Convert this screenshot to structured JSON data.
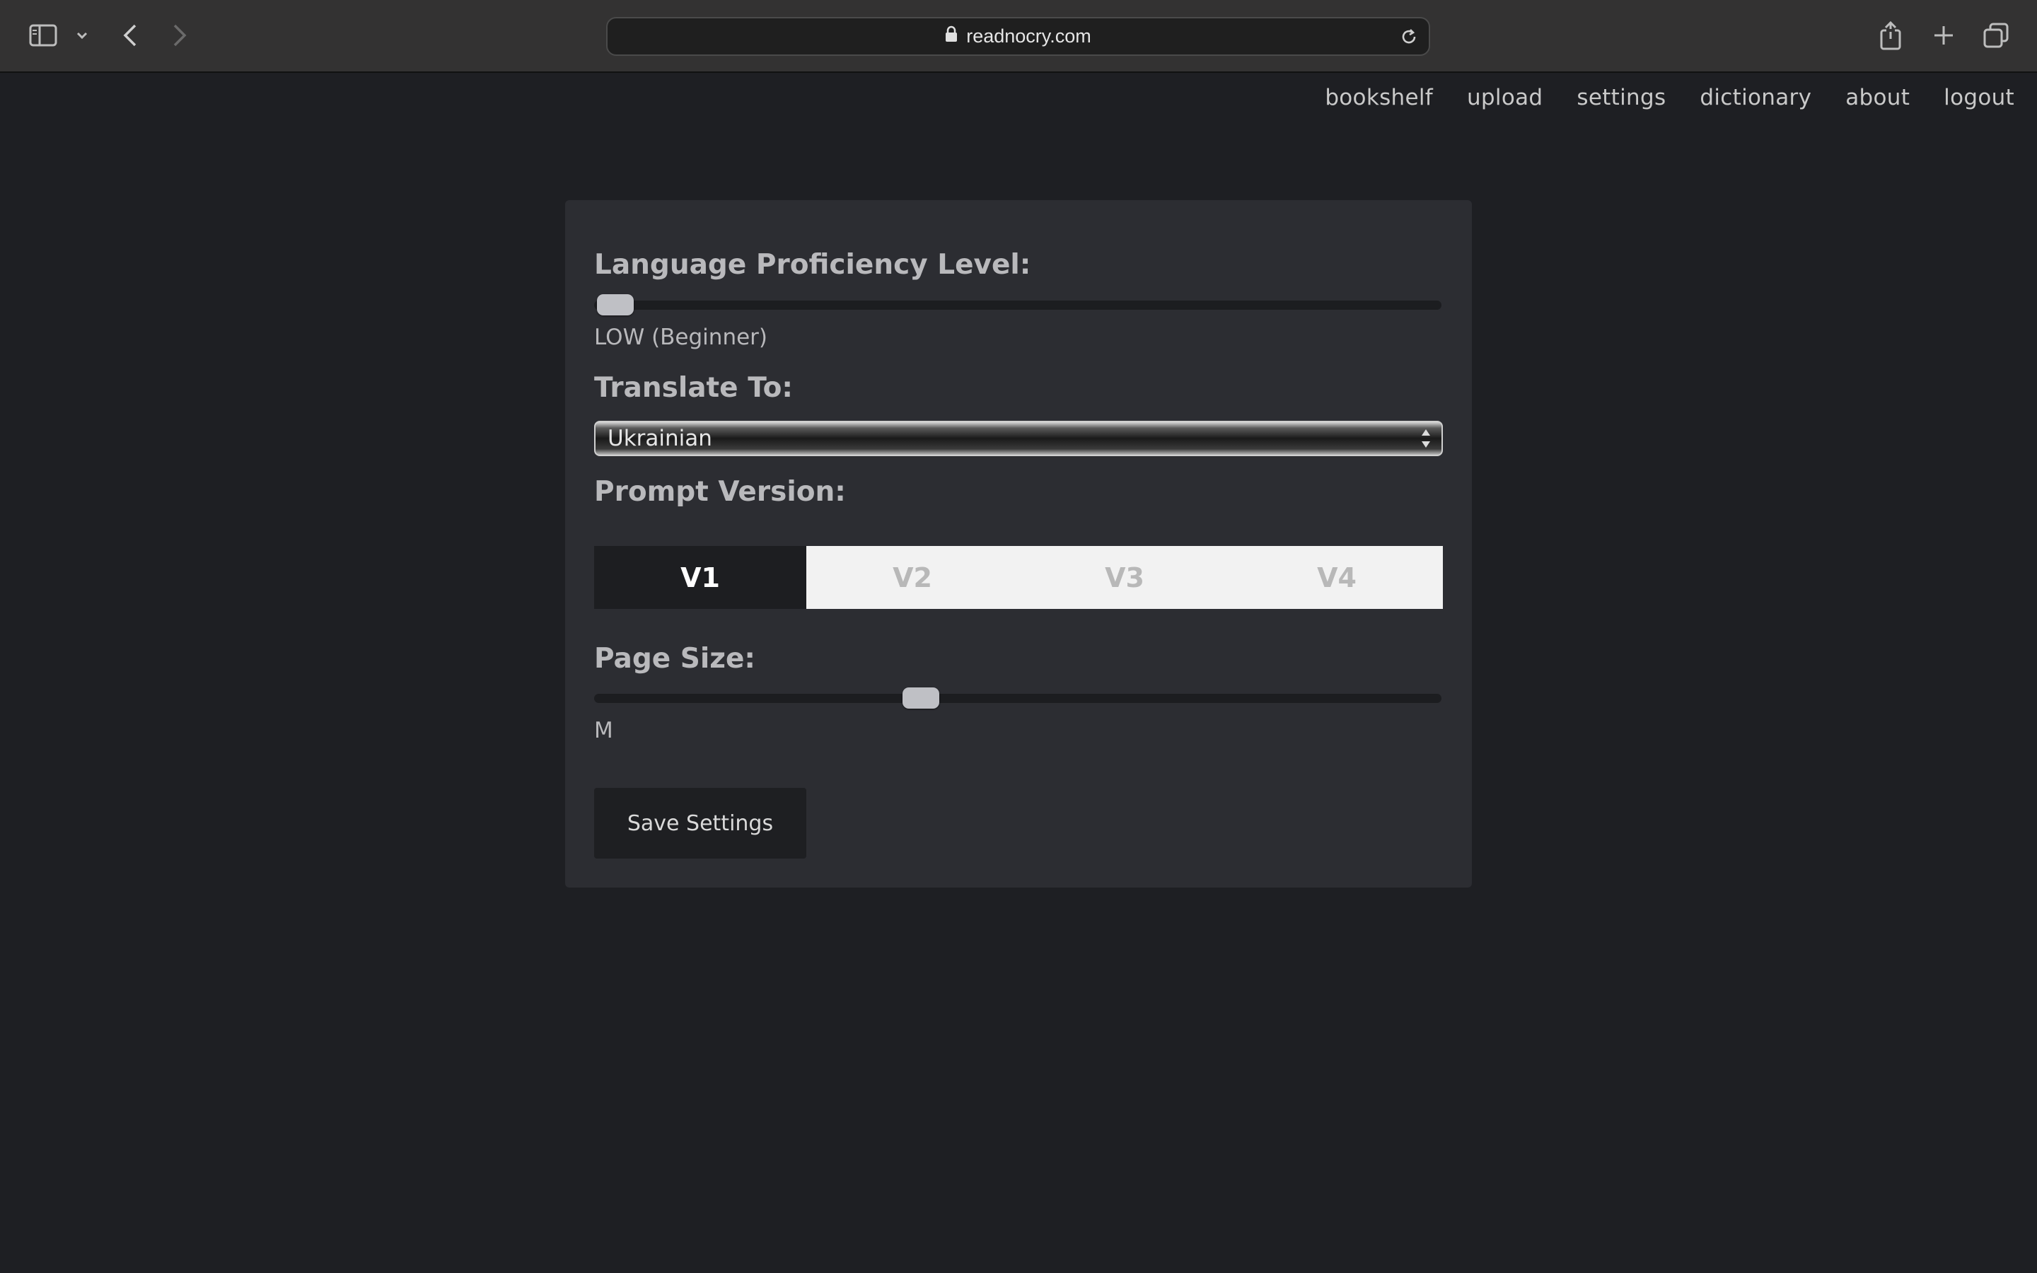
{
  "browser": {
    "url": "readnocry.com",
    "icons": [
      "sidebar-icon",
      "chevron-down-icon",
      "back-icon",
      "forward-icon",
      "lock-icon",
      "reload-icon",
      "share-icon",
      "plus-icon",
      "tabs-icon"
    ]
  },
  "nav": {
    "items": [
      "bookshelf",
      "upload",
      "settings",
      "dictionary",
      "about",
      "logout"
    ]
  },
  "settings": {
    "proficiency": {
      "label": "Language Proficiency Level:",
      "value_text": "LOW (Beginner)",
      "level_fraction": 0.0
    },
    "translate": {
      "label": "Translate To:",
      "selected": "Ukrainian"
    },
    "prompt": {
      "label": "Prompt Version:",
      "options": [
        "V1",
        "V2",
        "V3",
        "V4"
      ],
      "selected": "V1"
    },
    "page_size": {
      "label": "Page Size:",
      "value_text": "M",
      "level_fraction": 0.38
    },
    "save_label": "Save Settings"
  },
  "colors": {
    "background": "#1e1f23",
    "card": "#2c2d32",
    "segment_active": "#1d1e21",
    "segment_inactive": "#f2f2f2"
  }
}
